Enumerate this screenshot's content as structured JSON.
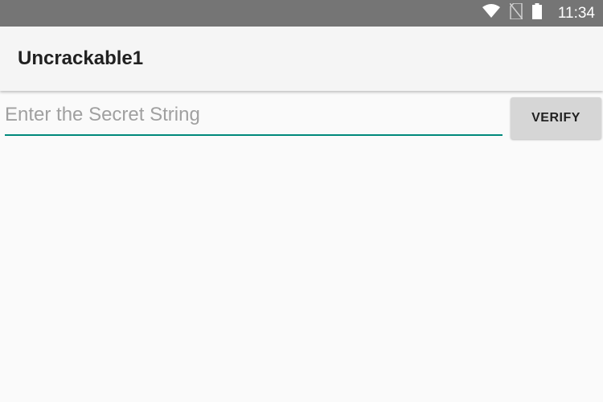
{
  "status_bar": {
    "time": "11:34",
    "icons": [
      "wifi-icon",
      "no-sim-icon",
      "battery-icon"
    ]
  },
  "app_bar": {
    "title": "Uncrackable1"
  },
  "main": {
    "secret_input": {
      "placeholder": "Enter the Secret String",
      "value": ""
    },
    "verify_label": "VERIFY"
  },
  "colors": {
    "status_bar": "#757575",
    "app_bar": "#f5f5f5",
    "accent": "#00897b",
    "button": "#d6d6d6"
  }
}
